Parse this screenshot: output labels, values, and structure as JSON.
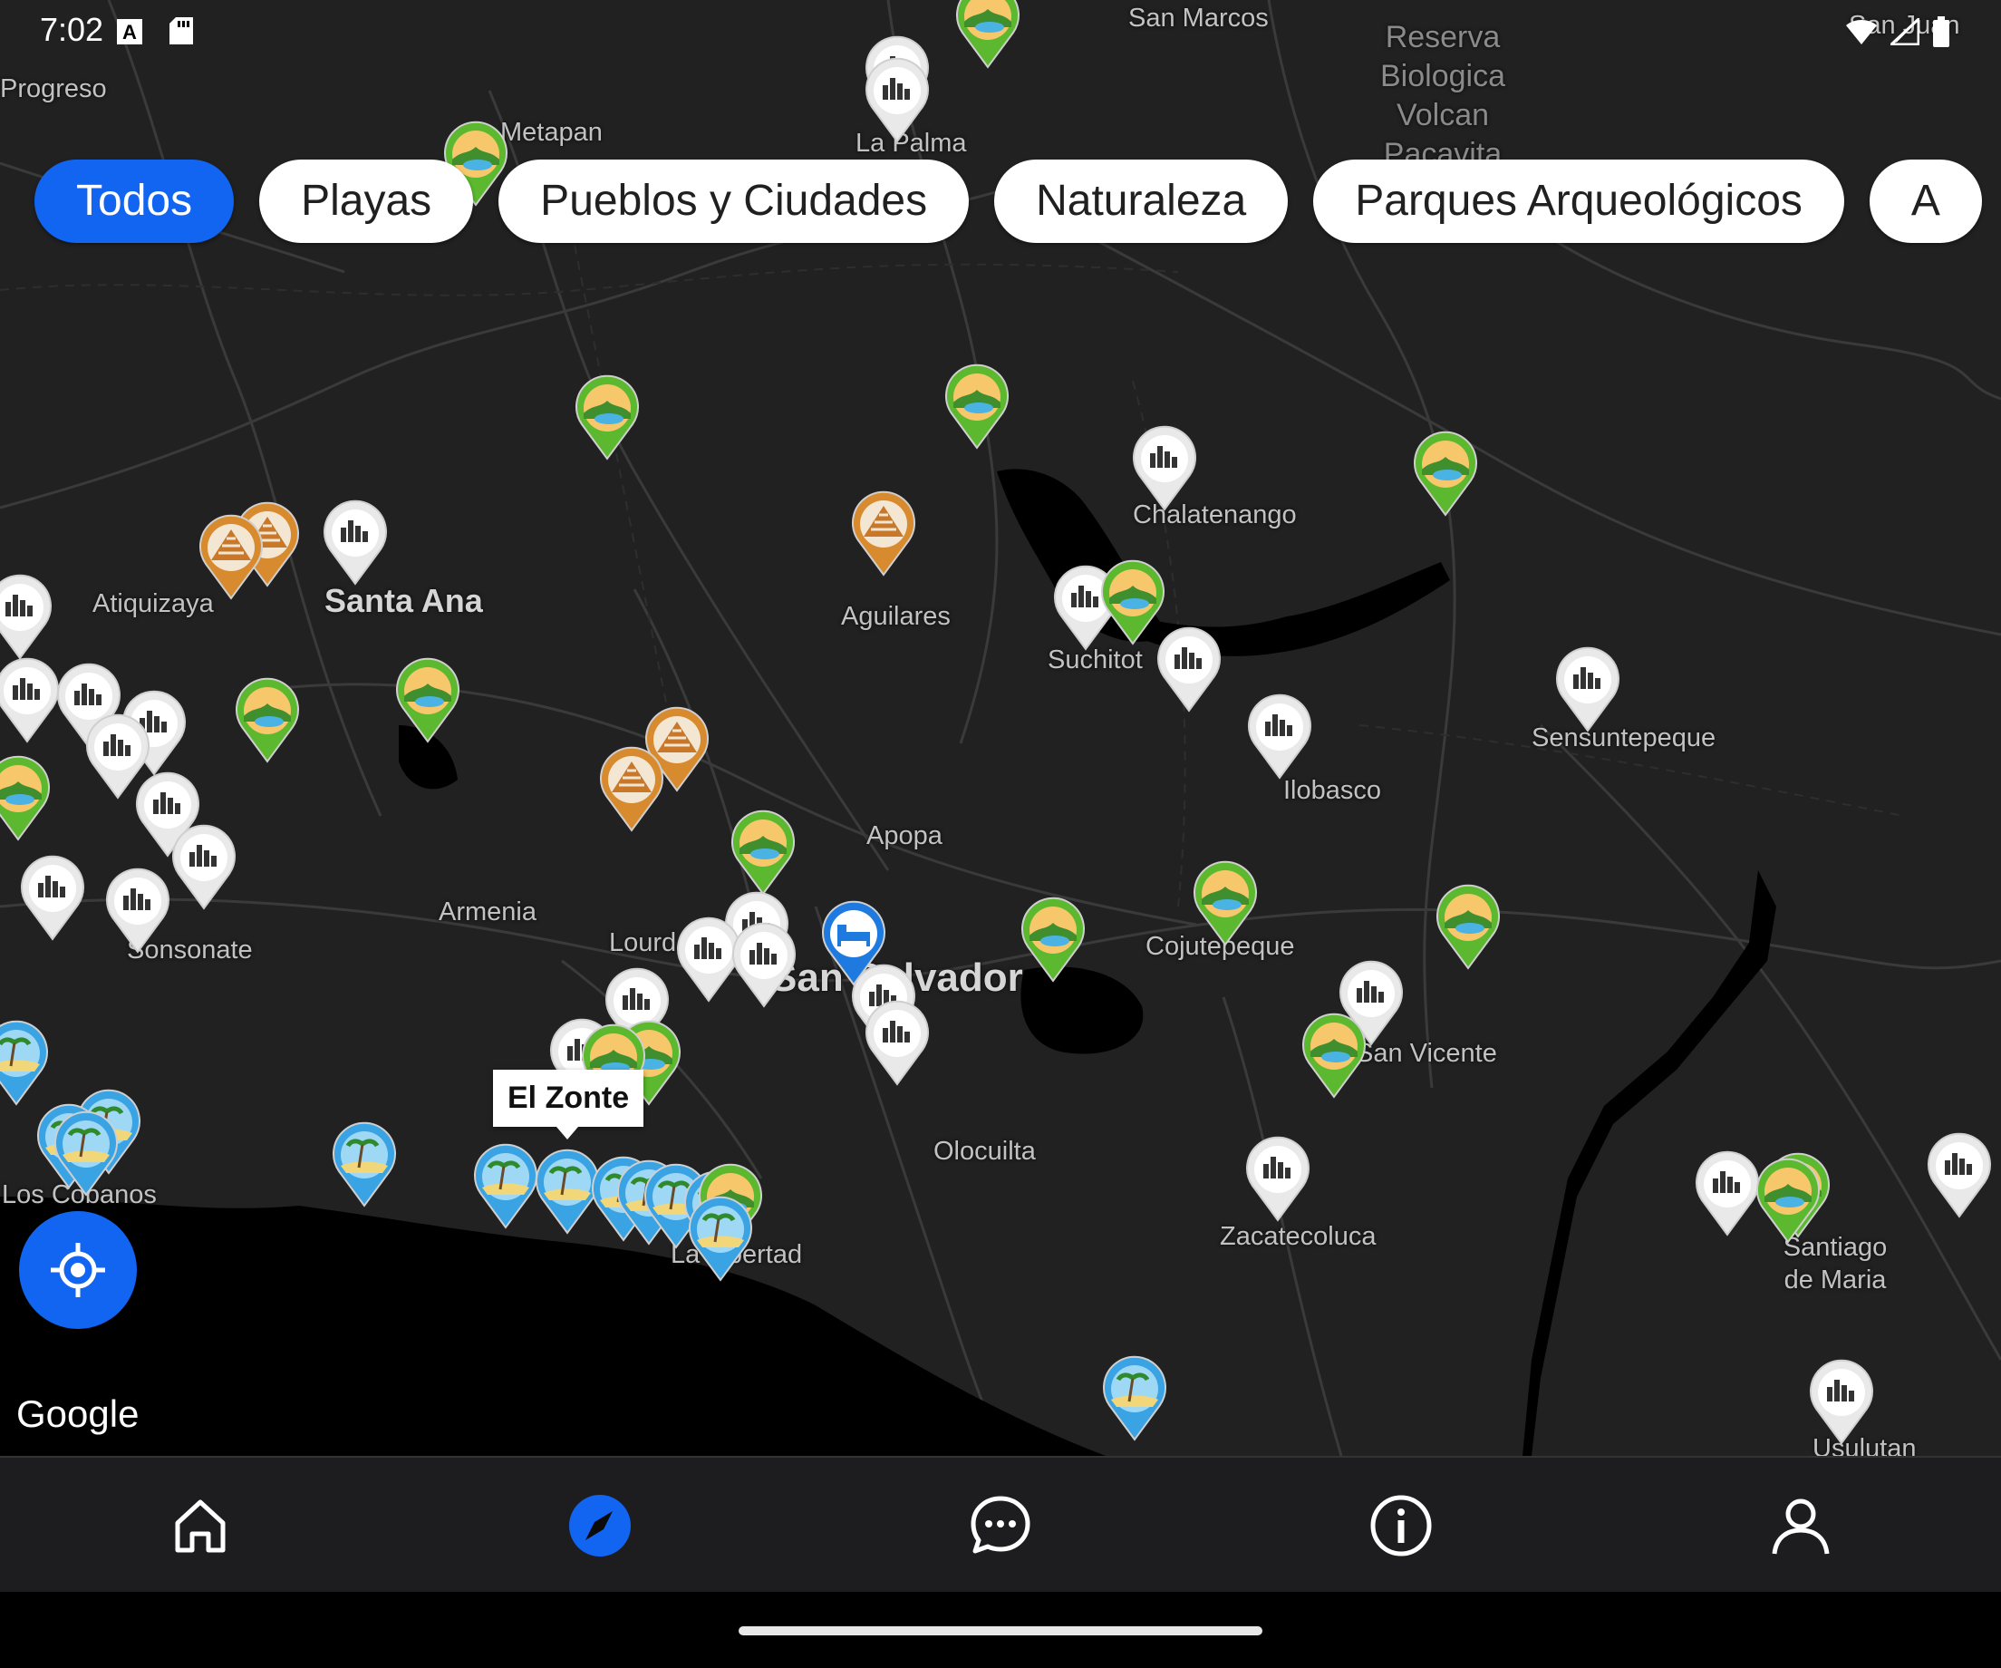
{
  "status_bar": {
    "time": "7:02",
    "icons": [
      "keyboard-a-icon",
      "sd-card-icon",
      "wifi-icon",
      "signal-icon",
      "battery-icon"
    ]
  },
  "filters": {
    "chips": [
      {
        "label": "Todos",
        "active": true
      },
      {
        "label": "Playas",
        "active": false
      },
      {
        "label": "Pueblos y Ciudades",
        "active": false
      },
      {
        "label": "Naturaleza",
        "active": false
      },
      {
        "label": "Parques Arqueológicos",
        "active": false
      },
      {
        "label": "A",
        "active": false
      }
    ]
  },
  "map": {
    "places": [
      {
        "label": "San Marcos"
      },
      {
        "label": "San Juan"
      },
      {
        "label": "Reserva Biologica Volcan Pacavita"
      },
      {
        "label": "Progreso"
      },
      {
        "label": "Metapan"
      },
      {
        "label": "La Palma"
      },
      {
        "label": "Chalatenango"
      },
      {
        "label": "Atiquizaya"
      },
      {
        "label": "Santa Ana"
      },
      {
        "label": "Aguilares"
      },
      {
        "label": "Suchitot"
      },
      {
        "label": "Sensuntepeque"
      },
      {
        "label": "Ilobasco"
      },
      {
        "label": "Apopa"
      },
      {
        "label": "Armenia"
      },
      {
        "label": "Sonsonate"
      },
      {
        "label": "Lourd"
      },
      {
        "label": "San Salvador"
      },
      {
        "label": "Cojutepeque"
      },
      {
        "label": "San Vicente"
      },
      {
        "label": "Olocuilta"
      },
      {
        "label": "Los Cobanos"
      },
      {
        "label": "La Libertad"
      },
      {
        "label": "Zacatecoluca"
      },
      {
        "label": "Santiago de Maria"
      },
      {
        "label": "Usulutan"
      }
    ],
    "tooltip": "El Zonte",
    "attribution": "Google",
    "marker_types": {
      "town": {
        "icon": "town-pin-icon",
        "color": "#e9e9e9"
      },
      "nature": {
        "icon": "nature-pin-icon",
        "color": "#5cb82e"
      },
      "beach": {
        "icon": "beach-pin-icon",
        "color": "#3aa3e3"
      },
      "archaeology": {
        "icon": "pyramid-pin-icon",
        "color": "#d88a2e"
      },
      "hotel": {
        "icon": "hotel-pin-icon",
        "color": "#1f7ae0"
      }
    }
  },
  "locate_button": {
    "icon": "my-location-icon"
  },
  "bottom_nav": [
    {
      "icon": "home-icon",
      "active": false
    },
    {
      "icon": "compass-icon",
      "active": true
    },
    {
      "icon": "chat-icon",
      "active": false
    },
    {
      "icon": "info-icon",
      "active": false
    },
    {
      "icon": "user-icon",
      "active": false
    }
  ],
  "colors": {
    "accent": "#1265f0",
    "map_background": "#212121",
    "nav_background": "#1d1d1f"
  }
}
